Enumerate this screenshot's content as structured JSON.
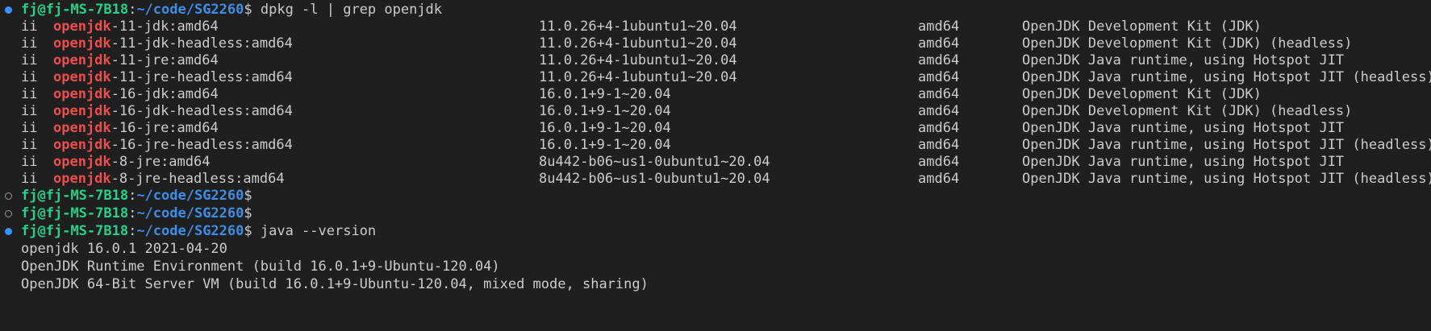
{
  "prompt": {
    "user_host": "fj@fj-MS-7B18",
    "colon": ":",
    "path": "~/code/SG2260",
    "symbol": "$"
  },
  "commands": {
    "dpkg": " dpkg -l | grep openjdk",
    "java": " java --version"
  },
  "packages": [
    {
      "status": "ii",
      "match": "openjdk",
      "rest": "-11-jdk:amd64",
      "version": "11.0.26+4-1ubuntu1~20.04",
      "arch": "amd64",
      "desc": "OpenJDK Development Kit (JDK)"
    },
    {
      "status": "ii",
      "match": "openjdk",
      "rest": "-11-jdk-headless:amd64",
      "version": "11.0.26+4-1ubuntu1~20.04",
      "arch": "amd64",
      "desc": "OpenJDK Development Kit (JDK) (headless)"
    },
    {
      "status": "ii",
      "match": "openjdk",
      "rest": "-11-jre:amd64",
      "version": "11.0.26+4-1ubuntu1~20.04",
      "arch": "amd64",
      "desc": "OpenJDK Java runtime, using Hotspot JIT"
    },
    {
      "status": "ii",
      "match": "openjdk",
      "rest": "-11-jre-headless:amd64",
      "version": "11.0.26+4-1ubuntu1~20.04",
      "arch": "amd64",
      "desc": "OpenJDK Java runtime, using Hotspot JIT (headless)"
    },
    {
      "status": "ii",
      "match": "openjdk",
      "rest": "-16-jdk:amd64",
      "version": "16.0.1+9-1~20.04",
      "arch": "amd64",
      "desc": "OpenJDK Development Kit (JDK)"
    },
    {
      "status": "ii",
      "match": "openjdk",
      "rest": "-16-jdk-headless:amd64",
      "version": "16.0.1+9-1~20.04",
      "arch": "amd64",
      "desc": "OpenJDK Development Kit (JDK) (headless)"
    },
    {
      "status": "ii",
      "match": "openjdk",
      "rest": "-16-jre:amd64",
      "version": "16.0.1+9-1~20.04",
      "arch": "amd64",
      "desc": "OpenJDK Java runtime, using Hotspot JIT"
    },
    {
      "status": "ii",
      "match": "openjdk",
      "rest": "-16-jre-headless:amd64",
      "version": "16.0.1+9-1~20.04",
      "arch": "amd64",
      "desc": "OpenJDK Java runtime, using Hotspot JIT (headless)"
    },
    {
      "status": "ii",
      "match": "openjdk",
      "rest": "-8-jre:amd64",
      "version": "8u442-b06~us1-0ubuntu1~20.04",
      "arch": "amd64",
      "desc": "OpenJDK Java runtime, using Hotspot JIT"
    },
    {
      "status": "ii",
      "match": "openjdk",
      "rest": "-8-jre-headless:amd64",
      "version": "8u442-b06~us1-0ubuntu1~20.04",
      "arch": "amd64",
      "desc": "OpenJDK Java runtime, using Hotspot JIT (headless)"
    }
  ],
  "java_output": [
    "openjdk 16.0.1 2021-04-20",
    "OpenJDK Runtime Environment (build 16.0.1+9-Ubuntu-120.04)",
    "OpenJDK 64-Bit Server VM (build 16.0.1+9-Ubuntu-120.04, mixed mode, sharing)"
  ],
  "colors": {
    "background": "#1f1f1f",
    "prompt_user": "#23d18b",
    "prompt_path": "#3b8eea",
    "grep_match": "#f14c4c",
    "decoration_success": "#3794ff",
    "decoration_default": "#9a9a9a"
  },
  "icons": {
    "command_success": "circle-filled-icon",
    "command_default": "circle-outline-icon"
  }
}
